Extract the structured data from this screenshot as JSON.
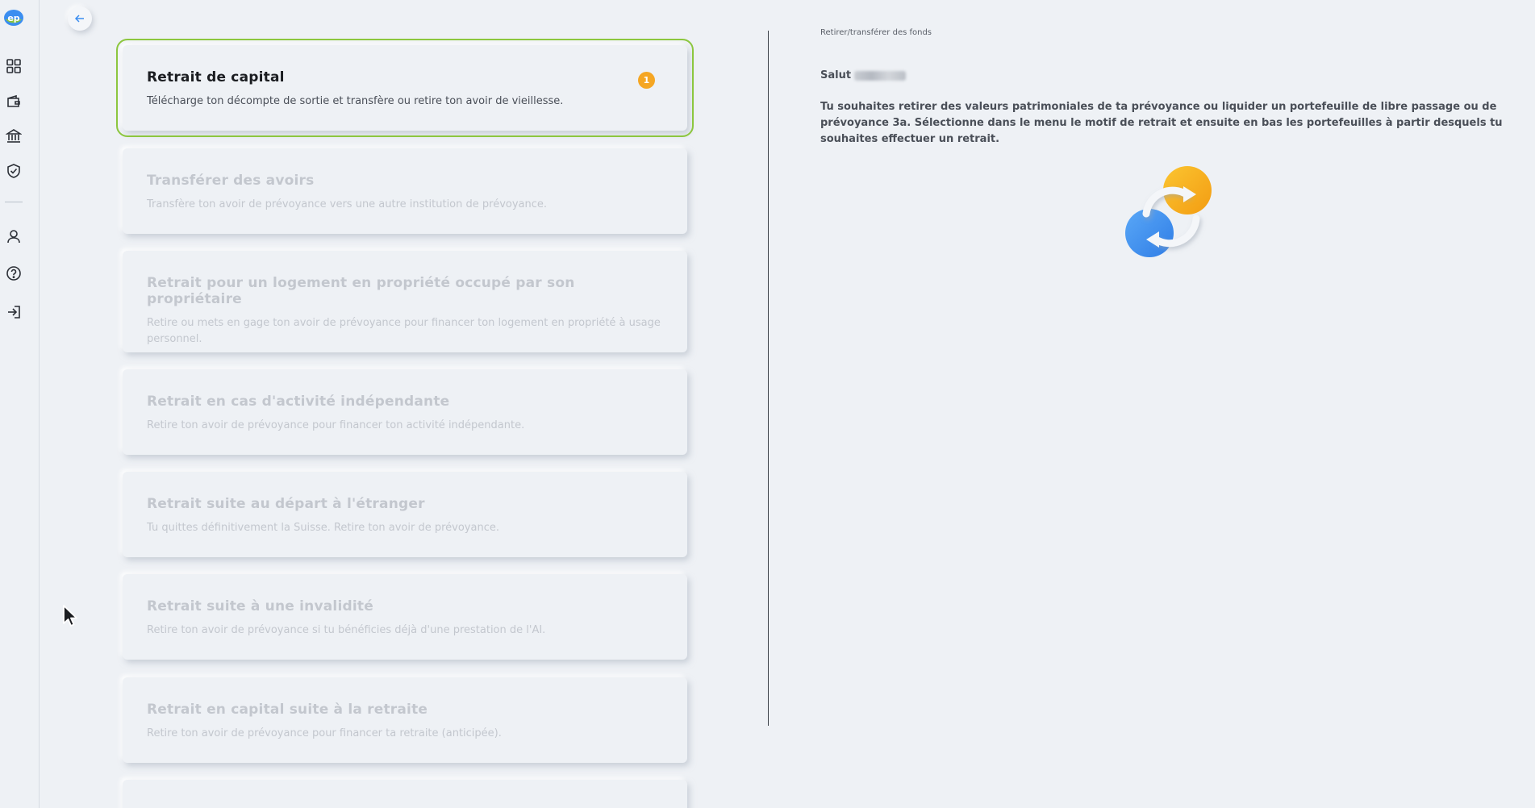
{
  "back": {
    "label": "Back"
  },
  "cards": [
    {
      "title": "Retrait de capital",
      "desc": "Télécharge ton décompte de sortie et transfère ou retire ton avoir de vieillesse.",
      "badge": "1"
    },
    {
      "title": "Transférer des avoirs",
      "desc": "Transfère ton avoir de prévoyance vers une autre institution de prévoyance."
    },
    {
      "title": "Retrait pour un logement en propriété occupé par son propriétaire",
      "desc": "Retire ou mets en gage ton avoir de prévoyance pour financer ton logement en propriété à usage personnel."
    },
    {
      "title": "Retrait en cas d'activité indépendante",
      "desc": "Retire ton avoir de prévoyance pour financer ton activité indépendante."
    },
    {
      "title": "Retrait suite au départ à l'étranger",
      "desc": "Tu quittes définitivement la Suisse. Retire ton avoir de prévoyance."
    },
    {
      "title": "Retrait suite à une invalidité",
      "desc": "Retire ton avoir de prévoyance si tu bénéficies déjà d'une prestation de l'AI."
    },
    {
      "title": "Retrait en capital suite à la retraite",
      "desc": "Retire ton avoir de prévoyance pour financer ta retraite (anticipée)."
    },
    {
      "title": "",
      "desc": ""
    }
  ],
  "right": {
    "breadcrumb": "Retirer/transférer des fonds",
    "greeting": "Salut",
    "intro": "Tu souhaites retirer des valeurs patrimoniales de ta prévoyance ou liquider un portefeuille de libre passage ou de prévoyance 3a. Sélectionne dans le menu le motif de retrait et ensuite en bas les portefeuilles à partir desquels tu souhaites effectuer un retrait."
  },
  "colors": {
    "accent": "#8cc63e",
    "badge": "#f5a623",
    "illus_blue": "#3b8ef0",
    "illus_orange": "#f7a91b"
  },
  "icons": [
    "logo-icon",
    "dashboard-icon",
    "wallet-icon",
    "bank-icon",
    "shield-icon",
    "user-icon",
    "help-icon",
    "logout-icon",
    "arrow-left-icon",
    "exchange-icon"
  ]
}
